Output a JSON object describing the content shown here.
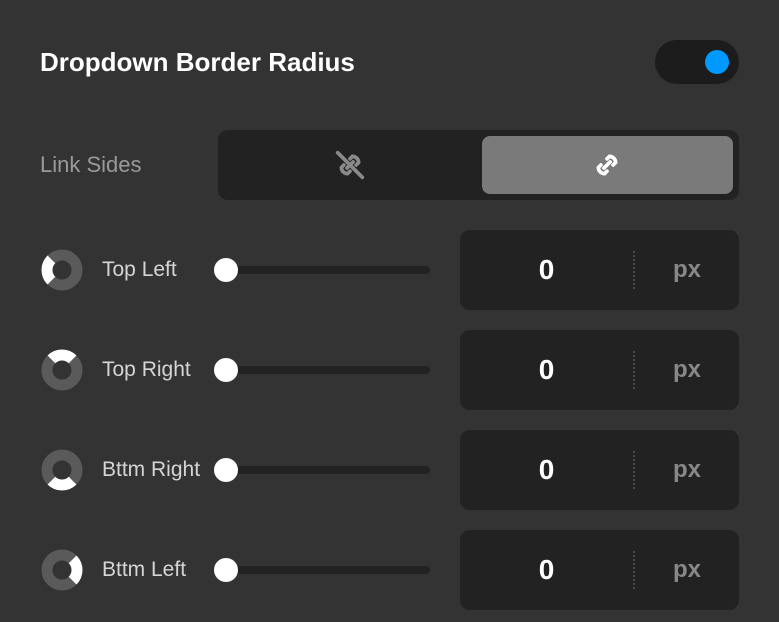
{
  "title": "Dropdown Border Radius",
  "toggle": {
    "enabled": true
  },
  "linkSides": {
    "label": "Link Sides",
    "linked": true
  },
  "unit": "px",
  "corners": [
    {
      "key": "top-left",
      "label": "Top Left",
      "value": "0",
      "arc_start": 225
    },
    {
      "key": "top-right",
      "label": "Top Right",
      "value": "0",
      "arc_start": 315
    },
    {
      "key": "bottom-right",
      "label": "Bttm Right",
      "value": "0",
      "arc_start": 135
    },
    {
      "key": "bottom-left",
      "label": "Bttm Left",
      "value": "0",
      "arc_start": 45
    }
  ]
}
